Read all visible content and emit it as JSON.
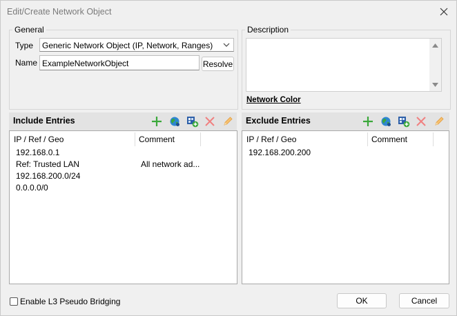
{
  "window": {
    "title": "Edit/Create Network Object"
  },
  "general": {
    "legend": "General",
    "type_label": "Type",
    "type_value": "Generic Network Object (IP, Network, Ranges)",
    "name_label": "Name",
    "name_value": "ExampleNetworkObject",
    "resolve_label": "Resolve"
  },
  "description": {
    "legend": "Description",
    "value": "",
    "network_color_label": "Network Color"
  },
  "include": {
    "header": "Include Entries",
    "columns": [
      "IP / Ref / Geo",
      "Comment"
    ],
    "rows": [
      {
        "ip": "192.168.0.1",
        "comment": ""
      },
      {
        "ip": "Ref: Trusted LAN",
        "comment": "All network ad..."
      },
      {
        "ip": "192.168.200.0/24",
        "comment": ""
      },
      {
        "ip": "0.0.0.0/0",
        "comment": ""
      }
    ]
  },
  "exclude": {
    "header": "Exclude Entries",
    "columns": [
      "IP / Ref / Geo",
      "Comment"
    ],
    "rows": [
      {
        "ip": "192.168.200.200",
        "comment": ""
      }
    ]
  },
  "toolbar_icons": [
    "add-icon",
    "globe-icon",
    "add-network-object-icon",
    "delete-icon",
    "edit-icon"
  ],
  "footer": {
    "bridging_label": "Enable L3 Pseudo Bridging",
    "bridging_checked": false,
    "ok_label": "OK",
    "cancel_label": "Cancel"
  },
  "colors": {
    "add_green": "#3aa83a",
    "delete_red": "#f08080",
    "edit_orange": "#f2b25a",
    "globe_blue": "#1f6fb8",
    "header_gray": "#e3e3e3"
  }
}
